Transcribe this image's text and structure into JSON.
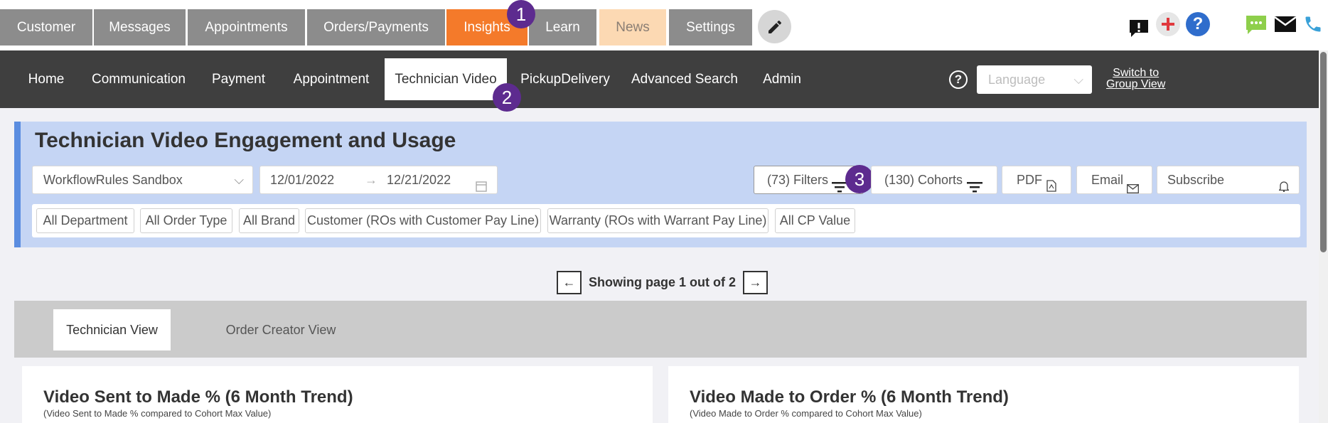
{
  "top_tabs": [
    "Customer",
    "Messages",
    "Appointments",
    "Orders/Payments",
    "Insights",
    "Learn",
    "News",
    "Settings"
  ],
  "badges": [
    "1",
    "2",
    "3"
  ],
  "top_icons": [
    "pencil-icon",
    "alert-message-icon",
    "plus-icon",
    "help-icon",
    "chat-icon",
    "mail-icon",
    "phone-icon"
  ],
  "nav": {
    "items": [
      "Home",
      "Communication",
      "Payment",
      "Appointment",
      "Technician Video",
      "PickupDelivery",
      "Advanced Search",
      "Admin"
    ],
    "language_placeholder": "Language",
    "switch_line1": "Switch to",
    "switch_line2": "Group View"
  },
  "report": {
    "title": "Technician Video Engagement and Usage",
    "store": "WorkflowRules Sandbox",
    "date_from": "12/01/2022",
    "date_to": "12/21/2022",
    "filters": "(73) Filters",
    "cohorts": "(130) Cohorts",
    "pdf": "PDF",
    "email": "Email",
    "subscribe": "Subscribe",
    "chips": [
      "All Department",
      "All Order Type",
      "All Brand",
      "Customer (ROs with Customer Pay Line)",
      "Warranty (ROs with Warrant Pay Line)",
      "All CP Value"
    ]
  },
  "pager": {
    "prev": "←",
    "text": "Showing page 1 out of 2",
    "next": "→"
  },
  "views": [
    "Technician View",
    "Order Creator View"
  ],
  "cards": [
    {
      "title": "Video Sent to Made % (6 Month Trend)",
      "subtitle": "(Video Sent to Made % compared to Cohort Max Value)"
    },
    {
      "title": "Video Made to Order % (6 Month Trend)",
      "subtitle": "(Video Made to Order % compared to Cohort Max Value)"
    }
  ],
  "colors": {
    "active_top": "#f47a2a",
    "news": "#fcd9b3",
    "nav_bg": "#3f3f3f",
    "badge": "#5d2b8f",
    "panel": "#c5d5f4",
    "panel_accent": "#5b8de0"
  }
}
